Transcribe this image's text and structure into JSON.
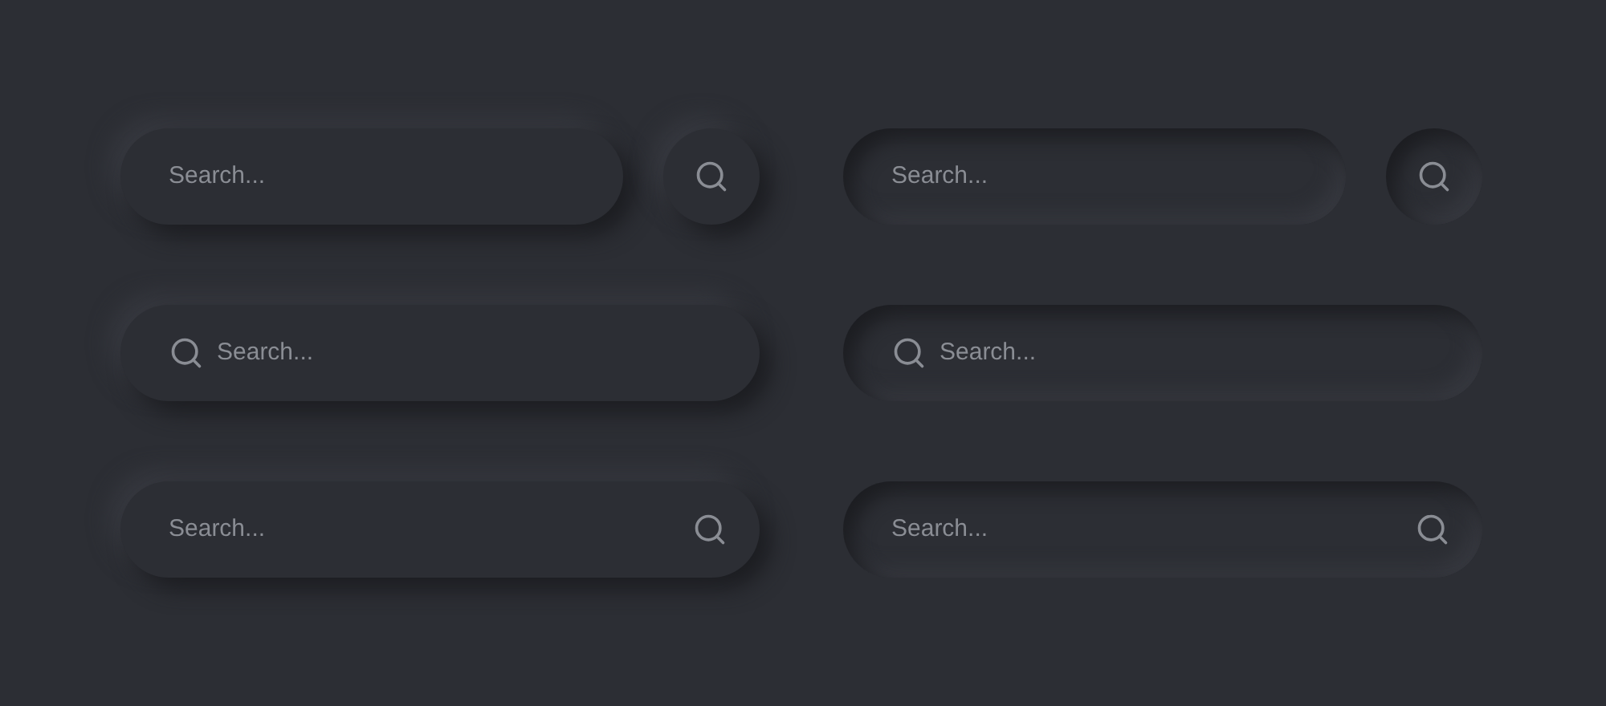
{
  "columns": [
    {
      "fields": [
        {
          "kind": "separate-button",
          "placeholder": "Search..."
        },
        {
          "kind": "icon-left",
          "placeholder": "Search..."
        },
        {
          "kind": "icon-right",
          "placeholder": "Search..."
        }
      ]
    },
    {
      "fields": [
        {
          "kind": "separate-button",
          "placeholder": "Search..."
        },
        {
          "kind": "icon-left",
          "placeholder": "Search..."
        },
        {
          "kind": "icon-right",
          "placeholder": "Search..."
        }
      ]
    }
  ]
}
